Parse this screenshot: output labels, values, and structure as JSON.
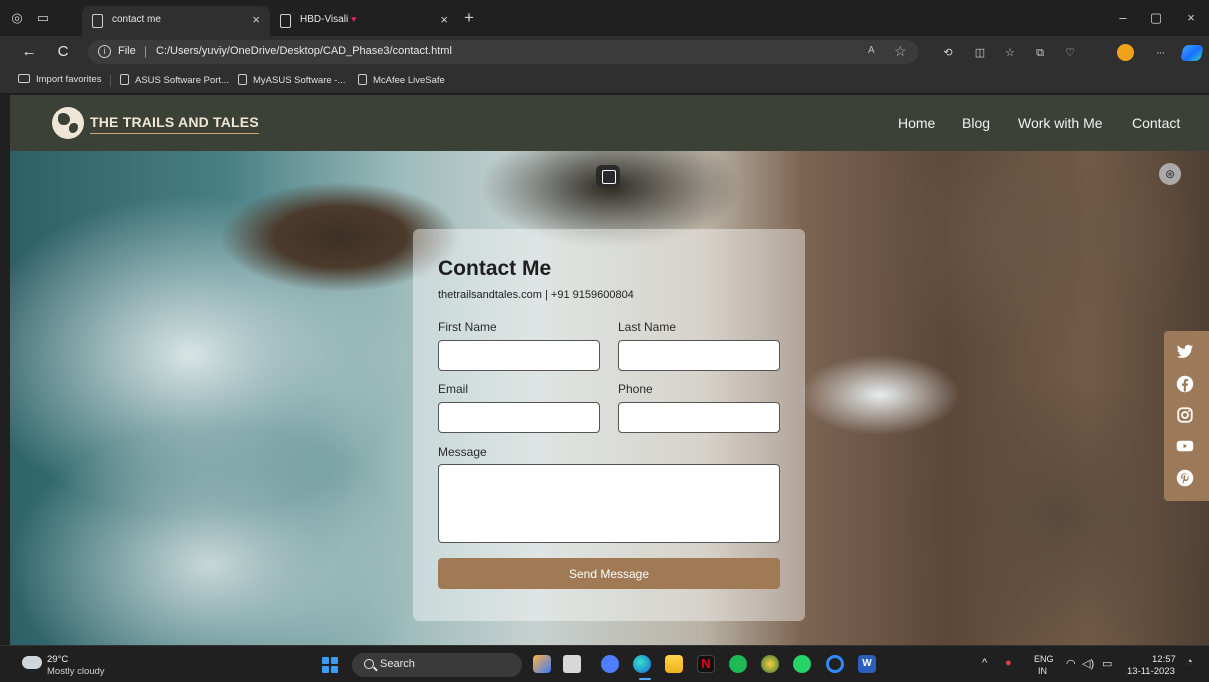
{
  "browser": {
    "tabs": [
      {
        "title": "contact me",
        "active": true
      },
      {
        "title": "HBD-Visali",
        "active": false
      }
    ],
    "url_scheme_label": "File",
    "url": "C:/Users/yuviy/OneDrive/Desktop/CAD_Phase3/contact.html",
    "favorites": [
      "Import favorites",
      "ASUS Software Port...",
      "MyASUS Software -...",
      "McAfee LiveSafe"
    ],
    "glyphs": {
      "close": "×",
      "new_tab": "+",
      "back": "←",
      "refresh": "C",
      "minimize": "–",
      "restore": "▢",
      "more": "···",
      "read_aloud": "A",
      "star": "☆"
    }
  },
  "site": {
    "logo_text": "THE TRAILS AND TALES",
    "nav": [
      "Home",
      "Blog",
      "Work with Me",
      "Contact"
    ],
    "contact": {
      "title": "Contact Me",
      "info": "thetrailsandtales.com | +91 9159600804",
      "labels": {
        "first_name": "First Name",
        "last_name": "Last Name",
        "email": "Email",
        "phone": "Phone",
        "message": "Message"
      },
      "values": {
        "first_name": "",
        "last_name": "",
        "email": "",
        "phone": "",
        "message": ""
      },
      "submit_label": "Send Message"
    },
    "social_icons": [
      "twitter-icon",
      "facebook-icon",
      "instagram-icon",
      "youtube-icon",
      "pinterest-icon"
    ],
    "colors": {
      "nav_bg": "#3b4136",
      "accent": "#a07a55",
      "social_bg": "#9c7a59",
      "logo_text": "#efe6d6"
    }
  },
  "taskbar": {
    "weather_temp": "29°C",
    "weather_desc": "Mostly cloudy",
    "search_placeholder": "Search",
    "lang_line1": "ENG",
    "lang_line2": "IN",
    "time": "12:57",
    "date": "13-11-2023"
  }
}
